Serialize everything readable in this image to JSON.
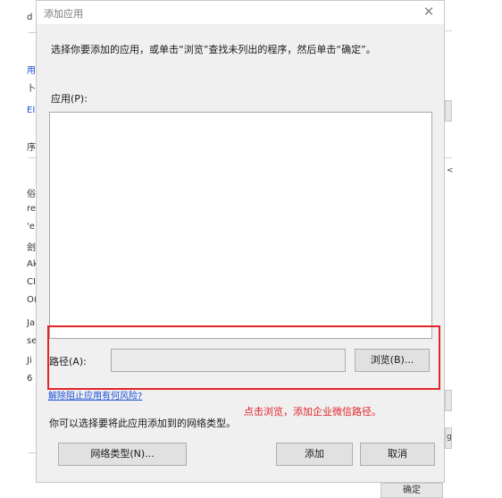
{
  "background": {
    "left_fragments": [
      "d",
      "用",
      "卜",
      "EI",
      "序",
      "俗",
      "re",
      "'e",
      "刽",
      "Ak",
      "CI",
      "O(",
      "Ja",
      "se",
      "Ji",
      "6"
    ],
    "right_fragments": [
      "<",
      "g"
    ],
    "ok_button_label": "确定"
  },
  "dialog": {
    "title": "添加应用",
    "close_glyph": "✕",
    "instruction": "选择你要添加的应用，或单击“浏览”查找未列出的程序，然后单击“确定”。",
    "apps_label": "应用(P):",
    "path_label": "路径(A):",
    "path_value": "",
    "browse_label": "浏览(B)...",
    "risk_link": "解除阻止应用有何风险?",
    "type_hint": "你可以选择要将此应用添加到的网络类型。",
    "nettype_label": "网络类型(N)...",
    "add_label": "添加",
    "cancel_label": "取消"
  },
  "annotation": {
    "text": "点击浏览，添加企业微信路径。",
    "color": "#e0252b"
  }
}
